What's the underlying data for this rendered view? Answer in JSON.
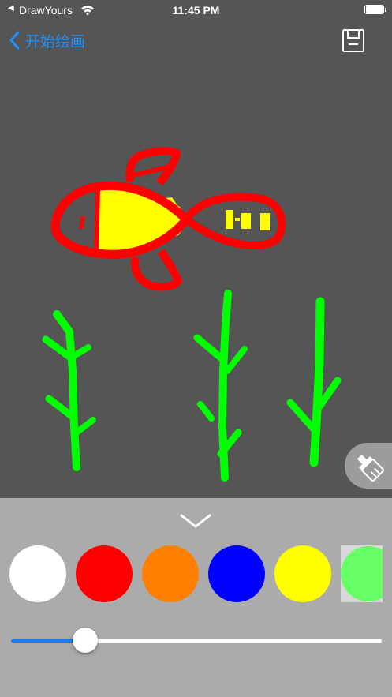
{
  "status_bar": {
    "back_app": "DrawYours",
    "time": "11:45 PM"
  },
  "nav": {
    "back_label": "开始绘画",
    "back_icon": "chevron-left-icon",
    "save_icon": "floppy-disk-icon"
  },
  "tools": {
    "brush_icon": "paint-brush-icon",
    "collapse_icon": "chevron-down-icon"
  },
  "palette": {
    "colors": [
      "#FFFFFF",
      "#FF0000",
      "#FF8000",
      "#0000FF",
      "#FFFF00",
      "#66FF66"
    ]
  },
  "brush_size": {
    "value_fraction": 0.2
  },
  "colors": {
    "accent": "#1E90FF",
    "canvas_bg": "#555555",
    "panel_bg": "#ABABAB"
  }
}
